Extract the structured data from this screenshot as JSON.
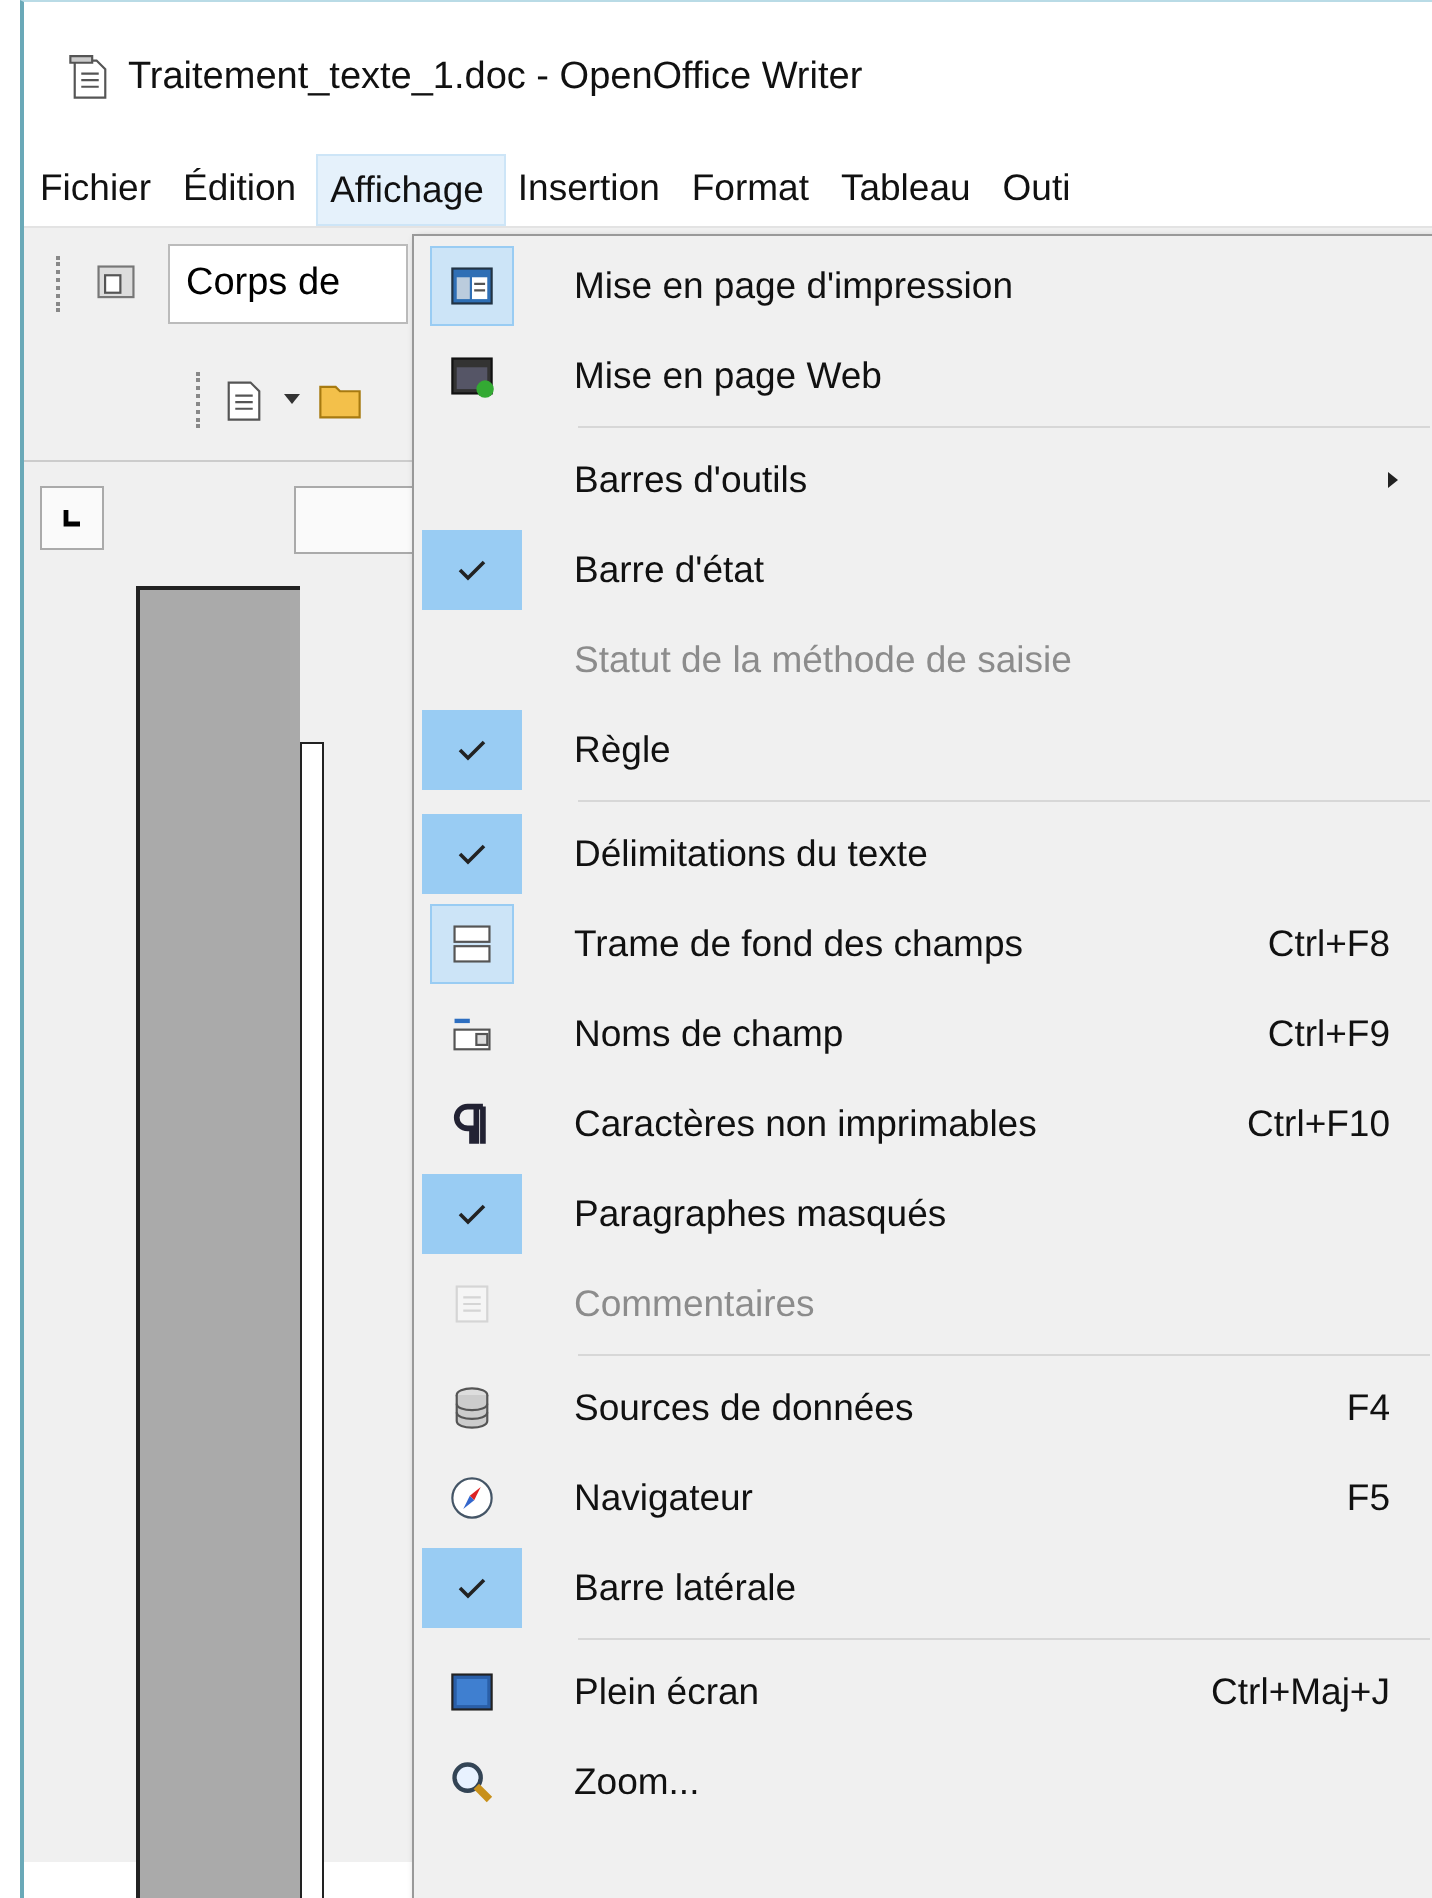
{
  "window": {
    "title": "Traitement_texte_1.doc - OpenOffice Writer"
  },
  "menubar": [
    {
      "label": "Fichier",
      "selected": false
    },
    {
      "label": "Édition",
      "selected": false
    },
    {
      "label": "Affichage",
      "selected": true
    },
    {
      "label": "Insertion",
      "selected": false
    },
    {
      "label": "Format",
      "selected": false
    },
    {
      "label": "Tableau",
      "selected": false
    },
    {
      "label": "Outi",
      "selected": false
    }
  ],
  "toolbar": {
    "style_box": "Corps de"
  },
  "menu": {
    "groups": [
      [
        {
          "label": "Mise en page d'impression",
          "checked": true,
          "disabled": false
        },
        {
          "label": "Mise en page Web",
          "checked": false,
          "disabled": false
        }
      ],
      [
        {
          "label": "Barres d'outils",
          "kind": "submenu",
          "checked": false,
          "disabled": false
        },
        {
          "label": "Barre d'état",
          "checked": true,
          "disabled": false
        },
        {
          "label": "Statut de la méthode de saisie",
          "checked": false,
          "disabled": true
        },
        {
          "label": "Règle",
          "checked": true,
          "disabled": false
        }
      ],
      [
        {
          "label": "Délimitations du texte",
          "checked": true,
          "disabled": false
        },
        {
          "label": "Trame de fond des champs",
          "shortcut": "Ctrl+F8",
          "checked": true,
          "disabled": false
        },
        {
          "label": "Noms de champ",
          "shortcut": "Ctrl+F9",
          "checked": false,
          "disabled": false
        },
        {
          "label": "Caractères non imprimables",
          "shortcut": "Ctrl+F10",
          "checked": false,
          "disabled": false
        },
        {
          "label": "Paragraphes masqués",
          "checked": true,
          "disabled": false
        },
        {
          "label": "Commentaires",
          "checked": false,
          "disabled": true
        }
      ],
      [
        {
          "label": "Sources de données",
          "shortcut": "F4",
          "checked": false,
          "disabled": false
        },
        {
          "label": "Navigateur",
          "shortcut": "F5",
          "checked": false,
          "disabled": false
        },
        {
          "label": "Barre latérale",
          "checked": true,
          "disabled": false
        }
      ],
      [
        {
          "label": "Plein écran",
          "shortcut": "Ctrl+Maj+J",
          "checked": false,
          "disabled": false
        },
        {
          "label": "Zoom...",
          "checked": false,
          "disabled": false
        }
      ]
    ]
  }
}
